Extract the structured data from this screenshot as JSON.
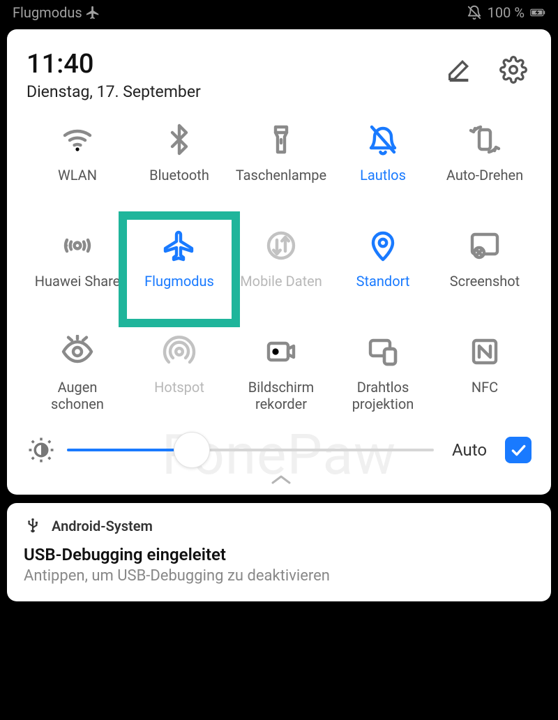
{
  "status": {
    "label": "Flugmodus",
    "battery": "100 %"
  },
  "header": {
    "time": "11:40",
    "date": "Dienstag, 17. September"
  },
  "tiles": [
    {
      "label": "WLAN",
      "icon": "wifi",
      "state": "off"
    },
    {
      "label": "Bluetooth",
      "icon": "bluetooth",
      "state": "off"
    },
    {
      "label": "Taschenlampe",
      "icon": "flashlight",
      "state": "off"
    },
    {
      "label": "Lautlos",
      "icon": "bell-off",
      "state": "active"
    },
    {
      "label": "Auto-Drehen",
      "icon": "rotate",
      "state": "off"
    },
    {
      "label": "Huawei Share",
      "icon": "share",
      "state": "off"
    },
    {
      "label": "Flugmodus",
      "icon": "airplane",
      "state": "active"
    },
    {
      "label": "Mobile Daten",
      "icon": "data",
      "state": "disabled"
    },
    {
      "label": "Standort",
      "icon": "location",
      "state": "active"
    },
    {
      "label": "Screenshot",
      "icon": "screenshot",
      "state": "off"
    },
    {
      "label": "Augen\nschonen",
      "icon": "eye",
      "state": "off"
    },
    {
      "label": "Hotspot",
      "icon": "hotspot",
      "state": "disabled"
    },
    {
      "label": "Bildschirm\nrekorder",
      "icon": "recorder",
      "state": "off"
    },
    {
      "label": "Drahtlos\nprojektion",
      "icon": "cast",
      "state": "off"
    },
    {
      "label": "NFC",
      "icon": "nfc",
      "state": "off"
    }
  ],
  "highlighted_tile_index": 6,
  "brightness": {
    "value": 34,
    "auto_label": "Auto",
    "auto_checked": true
  },
  "watermark": "FonePaw",
  "notification": {
    "app": "Android-System",
    "title": "USB-Debugging eingeleitet",
    "body": "Antippen, um USB-Debugging zu deaktivieren"
  }
}
